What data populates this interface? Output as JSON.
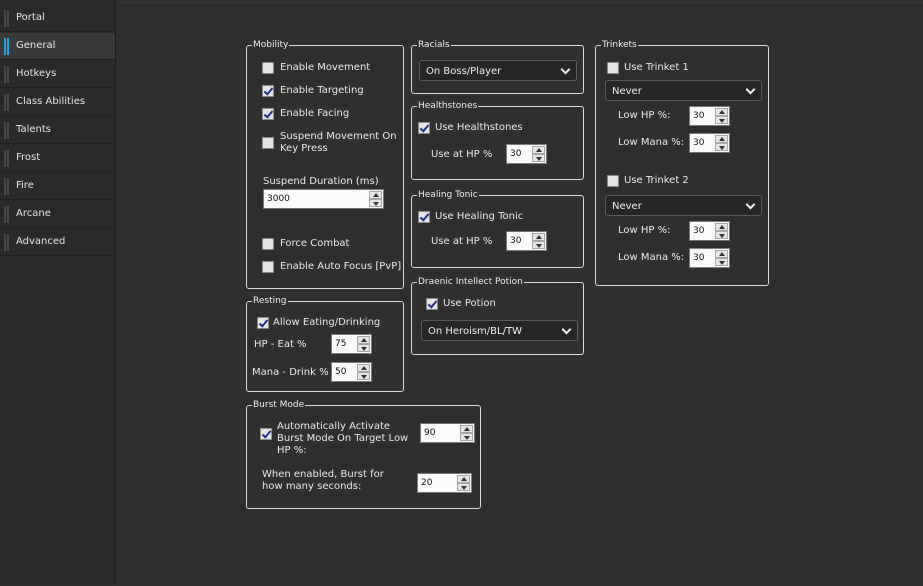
{
  "sidebar": {
    "items": [
      {
        "label": "Portal"
      },
      {
        "label": "General"
      },
      {
        "label": "Hotkeys"
      },
      {
        "label": "Class Abilities"
      },
      {
        "label": "Talents"
      },
      {
        "label": "Frost"
      },
      {
        "label": "Fire"
      },
      {
        "label": "Arcane"
      },
      {
        "label": "Advanced"
      }
    ],
    "active": "General"
  },
  "mobility": {
    "title": "Mobility",
    "enable_movement": {
      "label": "Enable Movement",
      "checked": false
    },
    "enable_targeting": {
      "label": "Enable Targeting",
      "checked": true
    },
    "enable_facing": {
      "label": "Enable Facing",
      "checked": true
    },
    "suspend_movement": {
      "label": "Suspend Movement On Key Press",
      "checked": false
    },
    "suspend_duration_label": "Suspend Duration (ms)",
    "suspend_duration_value": "3000",
    "force_combat": {
      "label": "Force Combat",
      "checked": false
    },
    "auto_focus": {
      "label": "Enable Auto Focus [PvP]",
      "checked": false
    }
  },
  "resting": {
    "title": "Resting",
    "allow_eating": {
      "label": "Allow Eating/Drinking",
      "checked": true
    },
    "hp_eat_label": "HP - Eat %",
    "hp_eat_value": "75",
    "mana_drink_label": "Mana - Drink %",
    "mana_drink_value": "50"
  },
  "burst": {
    "title": "Burst Mode",
    "auto_activate": {
      "label": "Automatically Activate Burst Mode On Target Low HP %:",
      "checked": true
    },
    "auto_activate_value": "90",
    "seconds_label": "When enabled, Burst for how many seconds:",
    "seconds_value": "20"
  },
  "racials": {
    "title": "Racials",
    "selected": "On Boss/Player"
  },
  "healthstones": {
    "title": "Healthstones",
    "use": {
      "label": "Use Healthstones",
      "checked": true
    },
    "hp_label": "Use at HP %",
    "hp_value": "30"
  },
  "healing_tonic": {
    "title": "Healing Tonic",
    "use": {
      "label": "Use Healing Tonic",
      "checked": true
    },
    "hp_label": "Use at HP %",
    "hp_value": "30"
  },
  "potion": {
    "title": "Draenic Intellect Potion",
    "use": {
      "label": "Use Potion",
      "checked": true
    },
    "selected": "On Heroism/BL/TW"
  },
  "trinkets": {
    "title": "Trinkets",
    "t1": {
      "label": "Use Trinket 1",
      "checked": false,
      "selected": "Never",
      "low_hp_label": "Low HP %:",
      "low_hp_value": "30",
      "low_mana_label": "Low Mana %:",
      "low_mana_value": "30"
    },
    "t2": {
      "label": "Use Trinket 2",
      "checked": false,
      "selected": "Never",
      "low_hp_label": "Low HP %:",
      "low_hp_value": "30",
      "low_mana_label": "Low Mana %:",
      "low_mana_value": "30"
    }
  },
  "colors": {
    "accent": "#19a8e6",
    "background": "#2f2f2f",
    "group_border": "#d8d8d8"
  }
}
